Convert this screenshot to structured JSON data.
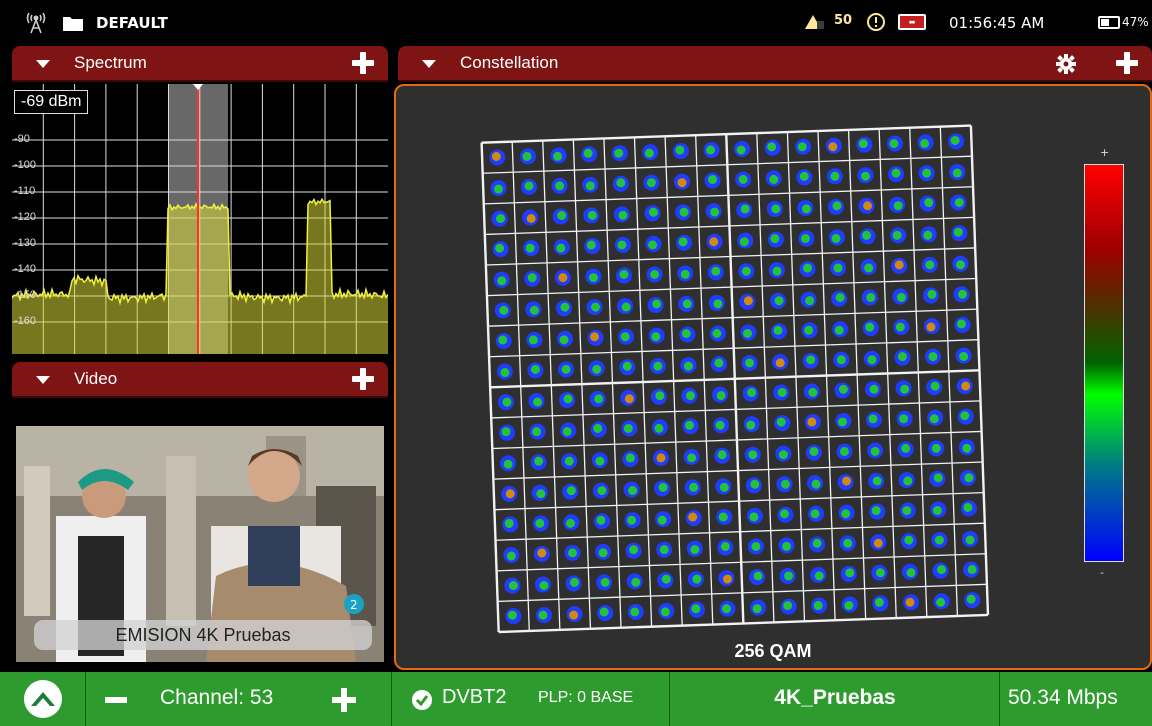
{
  "status_bar": {
    "profile": "DEFAULT",
    "indicator_50": "50",
    "time": "01:56:45 AM",
    "battery": "47%",
    "battery_level": 0.47
  },
  "spectrum": {
    "title": "Spectrum",
    "level": "-69 dBm",
    "y_ticks": [
      "-90",
      "-100",
      "-110",
      "-120",
      "-130",
      "-140",
      "-150",
      "-160"
    ]
  },
  "video": {
    "title": "Video",
    "caption": "EMISION 4K Pruebas",
    "overlay_badge": "2"
  },
  "constellation": {
    "title": "Constellation",
    "modulation": "256 QAM",
    "scale_plus": "+",
    "scale_minus": "-"
  },
  "bottom_bar": {
    "channel": "Channel: 53",
    "standard": "DVBT2",
    "plp": "PLP: 0 BASE",
    "service": "4K_Pruebas",
    "bitrate": "50.34 Mbps"
  },
  "colors": {
    "panel_header": "#7e1414",
    "accent_orange": "#e26b12",
    "bottom_green": "#2e9b2e",
    "trace_yellow": "#d8d83a"
  },
  "icons": [
    "antenna-icon",
    "folder-icon",
    "satellite-icon",
    "warning-icon",
    "gear-icon",
    "plus-icon",
    "collapse-triangle-icon",
    "logo-icon",
    "check-icon"
  ]
}
